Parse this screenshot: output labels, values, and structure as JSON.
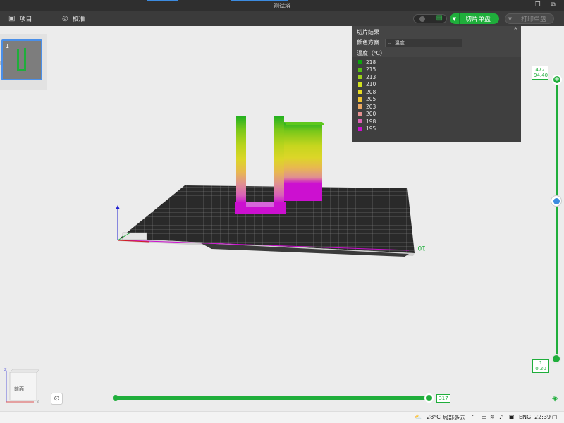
{
  "window": {
    "title": "测试塔",
    "controls": "❐ ⧉"
  },
  "toolbar": {
    "project_label": "项目",
    "calibrate_label": "校准",
    "slice_label": "切片单盘",
    "print_label": "打印单盘"
  },
  "plates": {
    "plate_number": "1",
    "side_mark": "D"
  },
  "results": {
    "title": "切片结果",
    "scheme_label": "颜色方案",
    "scheme_value": "温度",
    "unit_label": "温度（℃）",
    "legend": [
      {
        "value": "218",
        "color": "#0ca60c"
      },
      {
        "value": "215",
        "color": "#55c014"
      },
      {
        "value": "213",
        "color": "#9fd21a"
      },
      {
        "value": "210",
        "color": "#d2e11e"
      },
      {
        "value": "208",
        "color": "#e8dc22"
      },
      {
        "value": "205",
        "color": "#efc432"
      },
      {
        "value": "203",
        "color": "#eda864"
      },
      {
        "value": "200",
        "color": "#e69090"
      },
      {
        "value": "198",
        "color": "#de62b4"
      },
      {
        "value": "195",
        "color": "#cc10d0"
      }
    ]
  },
  "layer_slider": {
    "top_layer": "472",
    "top_height": "94.40",
    "bottom_layer": "1",
    "bottom_height": "0.20"
  },
  "move_slider": {
    "value": "317"
  },
  "viewcube": {
    "face_label": "前面"
  },
  "taskbar": {
    "weather": "28°C",
    "weather_desc": "局部多云",
    "lang": "ENG",
    "time": "22:39"
  }
}
